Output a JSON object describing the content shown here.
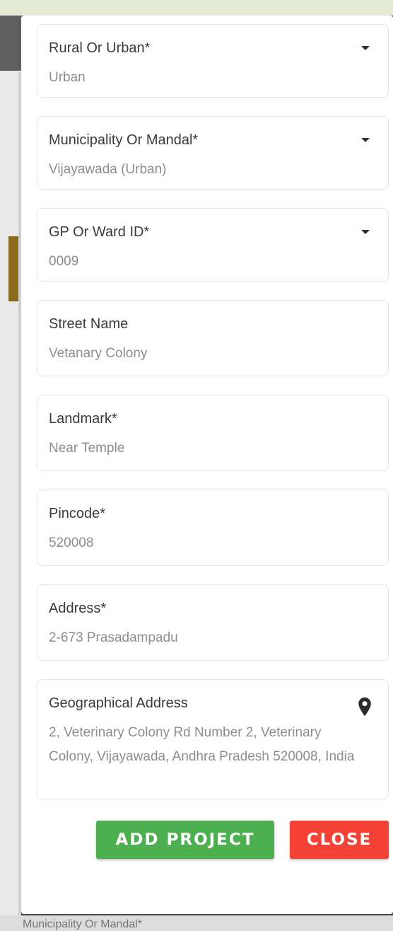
{
  "background": {
    "behind_text": "Municipality Or Mandal*"
  },
  "form": {
    "fields": [
      {
        "label": "Rural Or Urban*",
        "value": "Urban",
        "type": "dropdown"
      },
      {
        "label": "Municipality Or Mandal*",
        "value": "Vijayawada (Urban)",
        "type": "dropdown"
      },
      {
        "label": "GP Or Ward ID*",
        "value": "0009",
        "type": "dropdown"
      },
      {
        "label": "Street Name",
        "value": "Vetanary Colony",
        "type": "text"
      },
      {
        "label": "Landmark*",
        "value": "Near Temple",
        "type": "text"
      },
      {
        "label": "Pincode*",
        "value": "520008",
        "type": "text"
      },
      {
        "label": "Address*",
        "value": "2-673 Prasadampadu",
        "type": "text"
      },
      {
        "label": "Geographical Address",
        "value": "2, Veterinary Colony Rd Number 2, Veterinary Colony, Vijayawada, Andhra Pradesh 520008, India",
        "type": "location",
        "icon": "map-pin-icon"
      }
    ]
  },
  "buttons": {
    "add_label": "ADD PROJECT",
    "close_label": "CLOSE"
  },
  "colors": {
    "add": "#4caf50",
    "close": "#f44336"
  }
}
